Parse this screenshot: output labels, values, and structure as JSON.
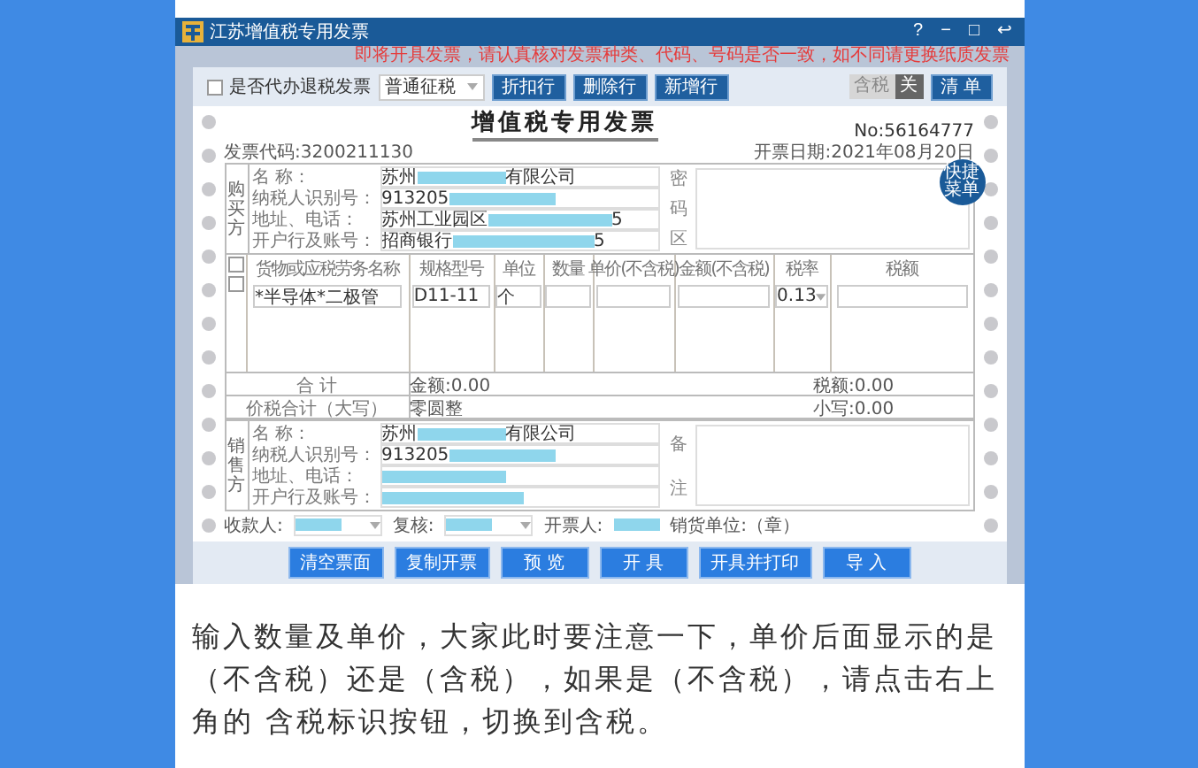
{
  "window": {
    "title": "江苏增值税专用发票",
    "controls": [
      "?",
      "−",
      "□",
      "↩"
    ]
  },
  "notice": "即将开具发票，请认真核对发票种类、代码、号码是否一致，如不同请更换纸质发票",
  "toolbar": {
    "agent_checkbox": {
      "label": "是否代办退税发票",
      "checked": false
    },
    "tax_mode": {
      "value": "普通征税"
    },
    "row_buttons": [
      "折扣行",
      "删除行",
      "新增行"
    ],
    "tax_toggle": {
      "label": "含税",
      "state_text": "关",
      "on": false
    },
    "list_button": "清 单"
  },
  "invoice": {
    "title": "增值税专用发票",
    "number": "No:56164777",
    "code": "发票代码:3200211130",
    "date": "开票日期:2021年08月20日",
    "buyer": {
      "side_label": "购买方",
      "fields": [
        {
          "label": "名 称：",
          "before": "苏州",
          "after": "有限公司",
          "redacted": true
        },
        {
          "label": "纳税人识别号：",
          "before": "913205",
          "redacted": true
        },
        {
          "label": "地址、电话：",
          "before": "苏州工业园区",
          "after": "5",
          "redacted": true
        },
        {
          "label": "开户行及账号：",
          "before": "招商银行",
          "after": "5",
          "redacted": true
        }
      ],
      "cipher_label": [
        "密",
        "码",
        "区"
      ],
      "quick_button": "快捷菜单"
    },
    "columns": [
      "货物或应税劳务名称",
      "规格型号",
      "单位",
      "数量",
      "单价(不含税)",
      "金额(不含税)",
      "税率",
      "税额"
    ],
    "header_checked": false,
    "rows": [
      {
        "checked": false,
        "cells": [
          "*半导体*二极管",
          "D11-11",
          "个",
          null,
          null,
          null,
          "0.13",
          null
        ]
      }
    ],
    "total": {
      "label": "合 计",
      "amount": "金额:0.00",
      "tax": "税额:0.00"
    },
    "grand_total": {
      "label": "价税合计（大写）",
      "words": "零圆整",
      "figure": "小写:0.00"
    },
    "seller": {
      "side_label": "销售方",
      "fields": [
        {
          "label": "名 称：",
          "before": "苏州",
          "after": "有限公司",
          "redacted": true
        },
        {
          "label": "纳税人识别号：",
          "before": "913205",
          "redacted": true
        },
        {
          "label": "地址、电话：",
          "redacted": true
        },
        {
          "label": "开户行及账号：",
          "redacted": true
        }
      ],
      "remark_label": [
        "备",
        "注"
      ]
    },
    "footer": [
      {
        "kind": "select",
        "label": "收款人:"
      },
      {
        "kind": "select",
        "label": "复核:"
      },
      {
        "kind": "plain",
        "label": "开票人:"
      },
      {
        "kind": "text",
        "label": "销货单位:（章）"
      }
    ]
  },
  "actions": [
    "清空票面",
    "复制开票",
    "预 览",
    "开 具",
    "开具并打印",
    "导 入"
  ],
  "caption": "输入数量及单价，大家此时要注意一下，单价后面显示的是（不含税）还是（含税），如果是（不含税），请点击右上角的 含税标识按钮，切换到含税。"
}
